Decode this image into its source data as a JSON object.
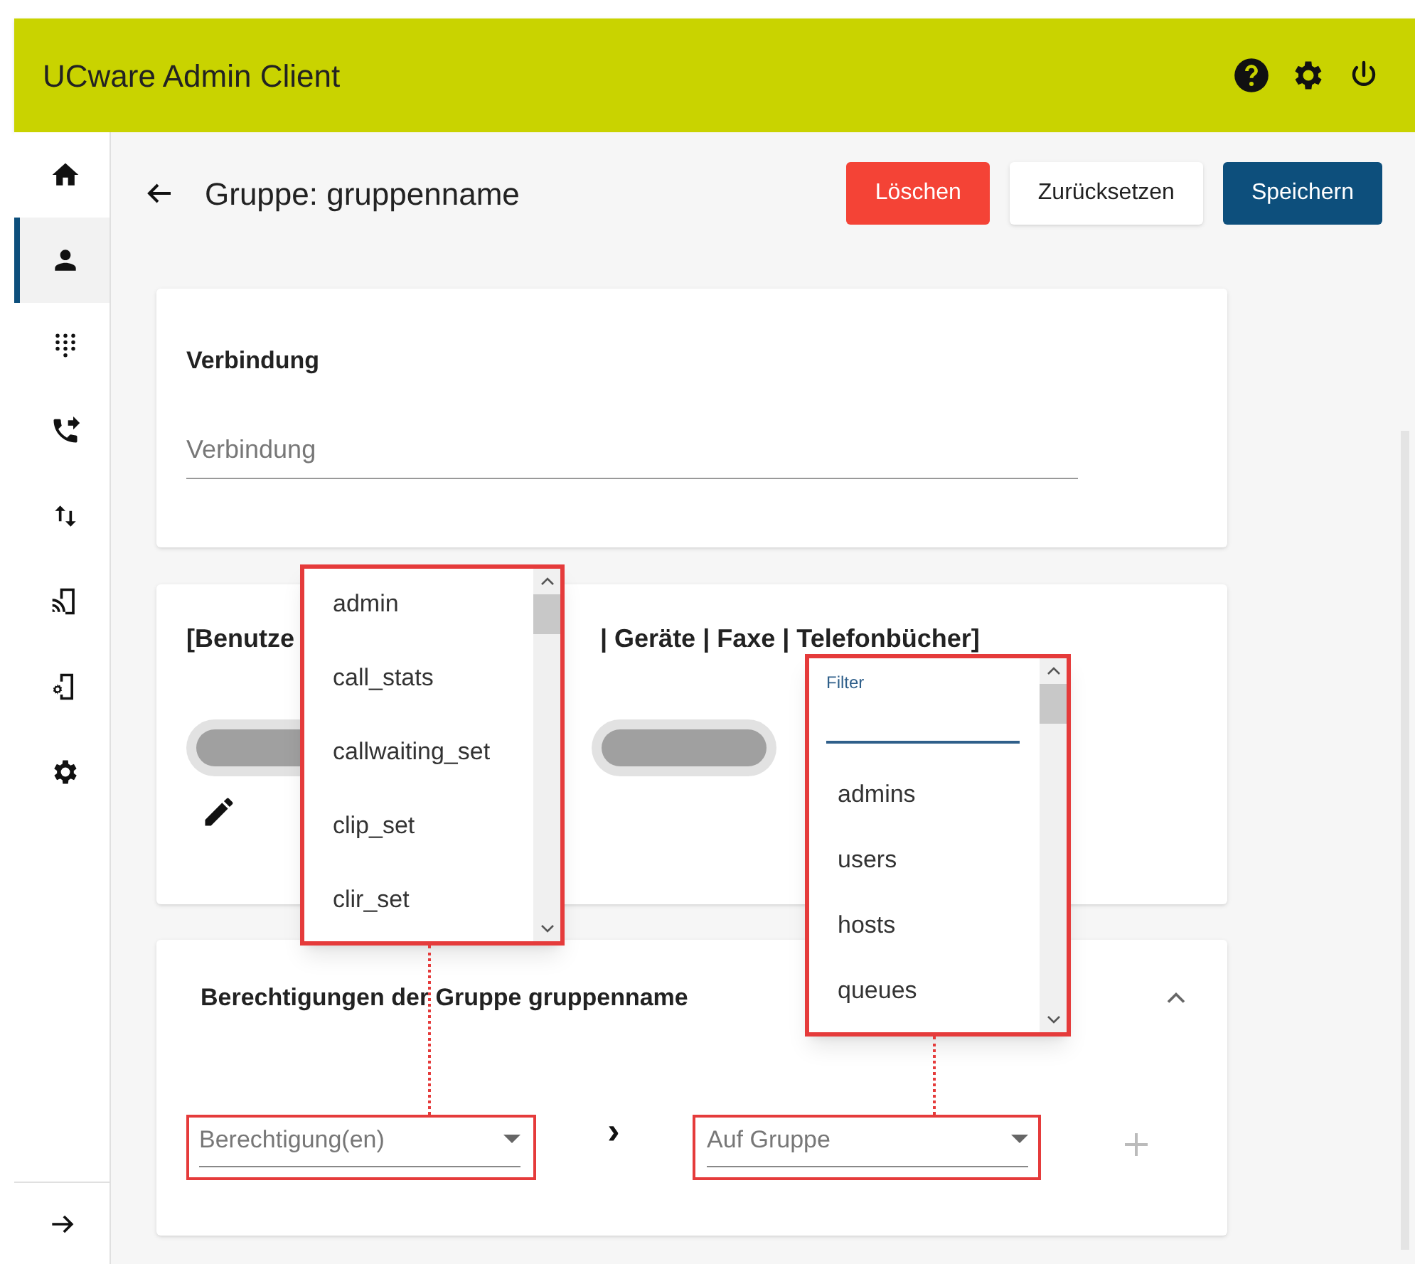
{
  "app_bar": {
    "title": "UCware Admin Client"
  },
  "sidebar": {
    "items": [
      {
        "selected": false
      },
      {
        "selected": true
      },
      {
        "selected": false
      },
      {
        "selected": false
      },
      {
        "selected": false
      },
      {
        "selected": false
      },
      {
        "selected": false
      },
      {
        "selected": false
      }
    ]
  },
  "header": {
    "title": "Gruppe: gruppenname",
    "buttons": [
      {
        "label": "Löschen",
        "kind": "danger"
      },
      {
        "label": "Zurücksetzen",
        "kind": "plain"
      },
      {
        "label": "Speichern",
        "kind": "primary"
      }
    ]
  },
  "connection_card": {
    "title": "Verbindung",
    "field": {
      "placeholder": "Verbindung"
    }
  },
  "members_card": {
    "title_parts": [
      "[Benutze",
      "| Geräte | Faxe | Telefonbücher]"
    ]
  },
  "permissions_card": {
    "title": "Berechtigungen der Gruppe gruppenname",
    "expanded": true,
    "permission_select": {
      "placeholder": "Berechtigung(en)"
    },
    "separator": "›",
    "group_select": {
      "placeholder": "Auf Gruppe"
    }
  },
  "permission_menu": {
    "items": [
      "admin",
      "call_stats",
      "callwaiting_set",
      "clip_set",
      "clir_set"
    ]
  },
  "group_menu": {
    "filter_label": "Filter",
    "items": [
      "admins",
      "users",
      "hosts",
      "queues"
    ]
  }
}
